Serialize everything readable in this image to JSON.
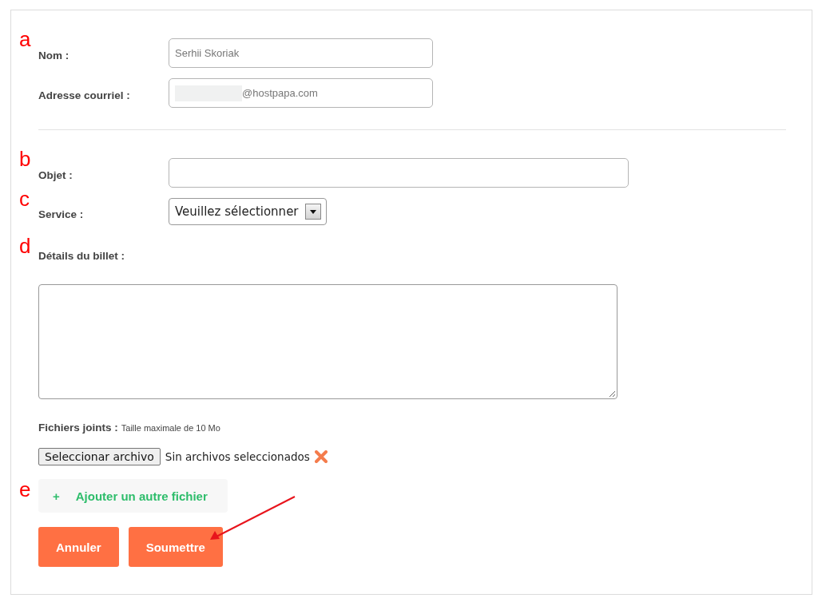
{
  "contact": [
    {
      "kind": "text",
      "label": "Nom :",
      "annotation": "a",
      "value": "Serhii Skoriak"
    },
    {
      "kind": "text",
      "label": "Adresse courriel :",
      "value": "@hostpapa.com",
      "redacted": true
    }
  ],
  "ticket": [
    {
      "kind": "text",
      "label": "Objet :",
      "annotation": "b"
    },
    {
      "kind": "select",
      "label": "Service :",
      "annotation": "c",
      "value": "Veuillez sélectionner"
    },
    {
      "kind": "textarea",
      "label": "Détails du billet :",
      "annotation": "d"
    }
  ],
  "attachments": {
    "label": "Fichiers joints :",
    "hint": "Taille maximale de 10 Mo",
    "file_button": "Seleccionar archivo",
    "file_status": "Sin archivos seleccionados",
    "add_icon": "+",
    "add_label": "Ajouter un autre fichier",
    "annotation": "e"
  },
  "buttons": [
    "Annuler",
    "Soumettre"
  ],
  "pointer_arrow": true
}
